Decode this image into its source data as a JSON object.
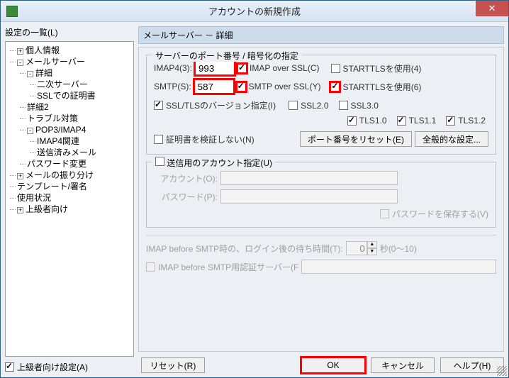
{
  "title": "アカウントの新規作成",
  "leftLabel": "設定の一覧(L)",
  "tree": {
    "n1": "個人情報",
    "n2": "メールサーバー",
    "n3": "詳細",
    "n4": "二次サーバー",
    "n5": "SSLでの証明書",
    "n6": "詳細2",
    "n7": "トラブル対策",
    "n8": "POP3/IMAP4",
    "n9": "IMAP4関連",
    "n10": "送信済みメール",
    "n11": "パスワード変更",
    "n12": "メールの振り分け",
    "n13": "テンプレート/署名",
    "n14": "使用状況",
    "n15": "上級者向け"
  },
  "advCheck": "上級者向け設定(A)",
  "sectionTitle": "メールサーバー － 詳細",
  "group1": {
    "legend": "サーバーのポート番号 / 暗号化の指定",
    "imapLabel": "IMAP4(3):",
    "imapPort": "993",
    "imapSSL": "IMAP over SSL(C)",
    "imapStartTLS": "STARTTLSを使用(4)",
    "smtpLabel": "SMTP(S):",
    "smtpPort": "587",
    "smtpSSL": "SMTP over SSL(Y)",
    "smtpStartTLS": "STARTTLSを使用(6)",
    "sslVer": "SSL/TLSのバージョン指定(I)",
    "ssl20": "SSL2.0",
    "ssl30": "SSL3.0",
    "tls10": "TLS1.0",
    "tls11": "TLS1.1",
    "tls12": "TLS1.2",
    "noCert": "証明書を検証しない(N)",
    "resetPort": "ポート番号をリセット(E)",
    "general": "全般的な設定..."
  },
  "group2": {
    "legend": "送信用のアカウント指定(U)",
    "account": "アカウント(O):",
    "password": "パスワード(P):",
    "savePw": "パスワードを保存する(V)"
  },
  "imapBefore": {
    "wait1": "IMAP before SMTP時の、ログイン後の待ち時間(T):",
    "waitVal": "0",
    "wait2": "秒(0～10)",
    "auth": "IMAP before SMTP用認証サーバー(F"
  },
  "buttons": {
    "reset": "リセット(R)",
    "ok": "OK",
    "cancel": "キャンセル",
    "help": "ヘルプ(H)"
  }
}
